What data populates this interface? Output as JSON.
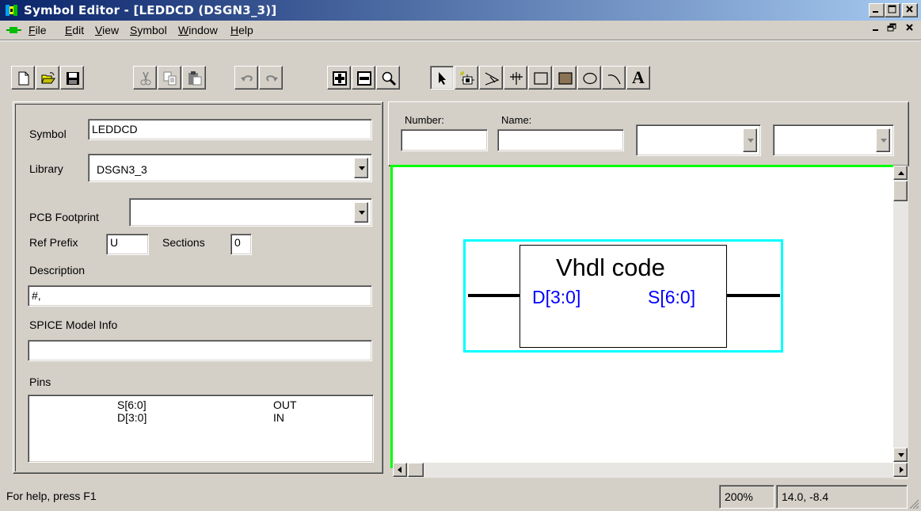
{
  "window": {
    "title": "Symbol Editor - [LEDDCD (DSGN3_3)]",
    "app_icon": "symbol-editor-icon",
    "controls": [
      "minimize",
      "maximize",
      "close"
    ]
  },
  "menu": {
    "items": [
      "File",
      "Edit",
      "View",
      "Symbol",
      "Window",
      "Help"
    ],
    "underlined": [
      "F",
      "E",
      "V",
      "S",
      "W",
      "H"
    ]
  },
  "toolbar": {
    "buttons": [
      "new-icon",
      "open-icon",
      "save-icon",
      "cut-icon",
      "copy-icon",
      "paste-icon",
      "undo-icon",
      "redo-icon",
      "zoom-in-icon",
      "zoom-out-icon",
      "zoom-area-icon",
      "select-arrow-icon",
      "place-part-icon",
      "draw-pin-icon",
      "draw-bus-icon",
      "rectangle-icon",
      "filled-rectangle-icon",
      "ellipse-icon",
      "arc-icon",
      "text-icon"
    ],
    "text_button_label": "A"
  },
  "properties": {
    "symbol_label": "Symbol",
    "symbol_value": "LEDDCD",
    "library_label": "Library",
    "library_value": "DSGN3_3",
    "pcb_label": "PCB Footprint",
    "pcb_value": "",
    "ref_prefix_label": "Ref Prefix",
    "ref_prefix_value": "U",
    "sections_label": "Sections",
    "sections_value": "0",
    "description_label": "Description",
    "description_value": "#,",
    "spice_label": "SPICE Model Info",
    "spice_value": "",
    "pins_label": "Pins",
    "pins": [
      {
        "name": "S[6:0]",
        "type": "OUT"
      },
      {
        "name": "D[3:0]",
        "type": "IN"
      }
    ]
  },
  "pin_editor": {
    "number_label": "Number:",
    "number_value": "",
    "name_label": "Name:",
    "name_value": "",
    "combo1_value": "",
    "combo2_value": ""
  },
  "canvas": {
    "border_color": "#00ff00",
    "outline_color": "#00ffff",
    "pin_label_color": "#0000ff",
    "symbol_title": "Vhdl code",
    "left_pin": "D[3:0]",
    "right_pin": "S[6:0]"
  },
  "status": {
    "help_text": "For help, press F1",
    "zoom": "200%",
    "coords": "14.0, -8.4"
  }
}
